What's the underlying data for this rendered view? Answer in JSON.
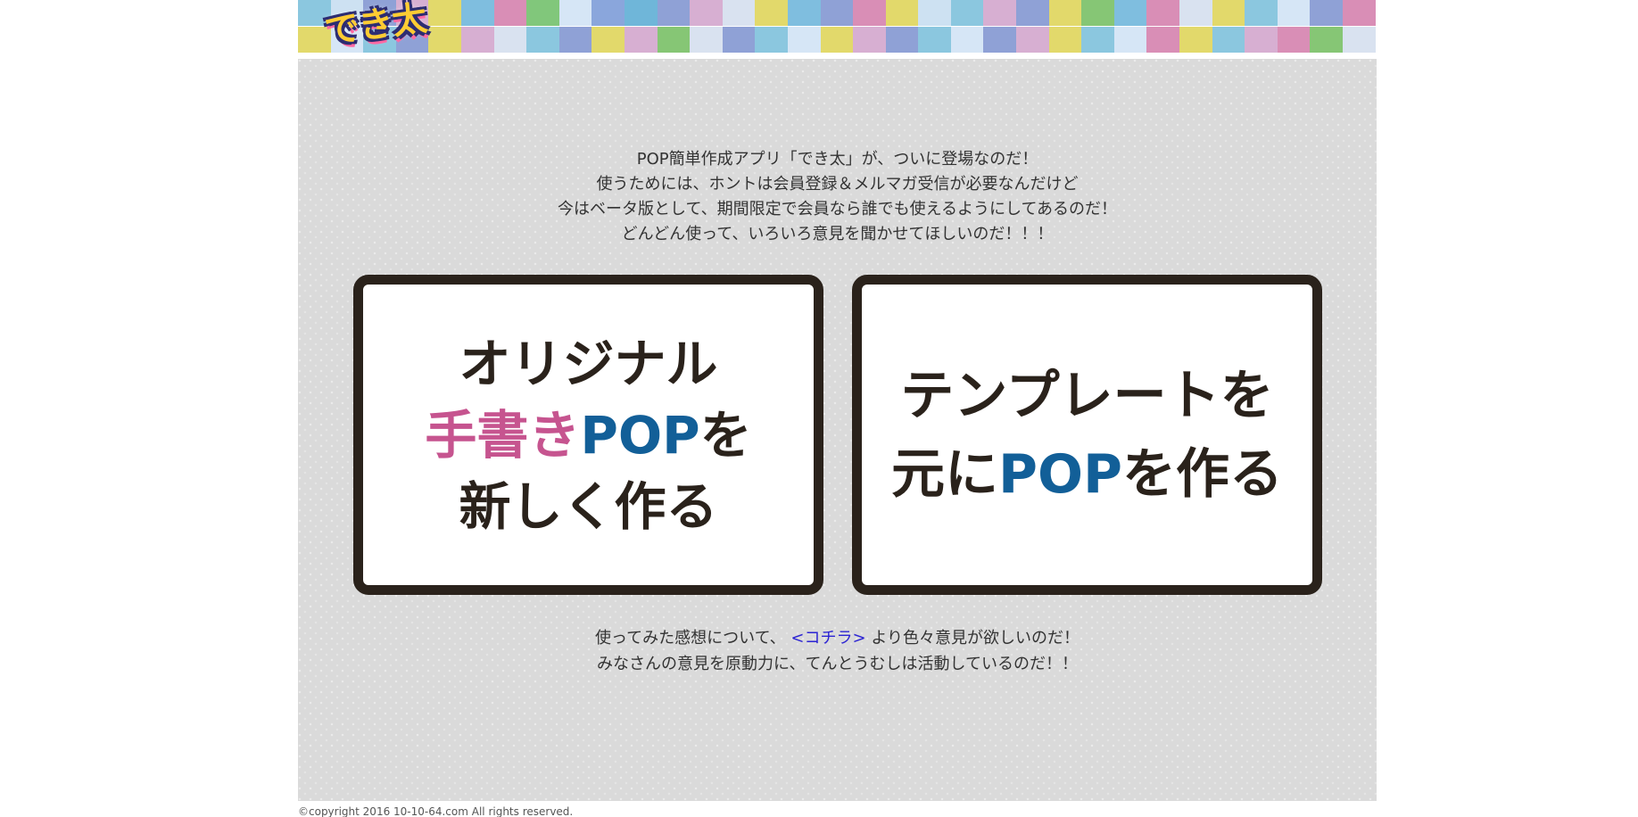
{
  "header": {
    "logo_text": "でき太",
    "checker_colors_top": [
      "#8bc7df",
      "#cde1f2",
      "#8fa1d6",
      "#d7afd2",
      "#e2d96b",
      "#7fbedf",
      "#d98eb6",
      "#81c77b",
      "#d6e6f6",
      "#8aa6dc",
      "#6fb6d9",
      "#8fa1d6",
      "#d7afd2",
      "#d9e2f0",
      "#e2d96b",
      "#7fbedf",
      "#8fa1d6",
      "#d98eb6",
      "#e2d96b",
      "#cde1f2",
      "#8bc7df",
      "#d7afd2",
      "#8fa1d6",
      "#e2d96b",
      "#86c675",
      "#7fbedf",
      "#d98eb6",
      "#d9e2f0",
      "#e2d96b",
      "#8bc7df",
      "#d6e6f6",
      "#8fa1d6",
      "#d98eb6"
    ],
    "checker_colors_bottom": [
      "#e2d96b",
      "#d6e6f6",
      "#8bc7df",
      "#8fa1d6",
      "#e2d96b",
      "#d7afd2",
      "#d9e2f0",
      "#8bc7df",
      "#8fa1d6",
      "#e2d96b",
      "#d7afd2",
      "#86c675",
      "#d9e2f0",
      "#8fa1d6",
      "#8bc7df",
      "#d6e6f6",
      "#e2d96b",
      "#d7afd2",
      "#8fa1d6",
      "#8bc7df",
      "#d6e6f6",
      "#8fa1d6",
      "#d7afd2",
      "#e2d96b",
      "#8bc7df",
      "#d6e6f6",
      "#d98eb6",
      "#e2d96b",
      "#8bc7df",
      "#d7afd2",
      "#d98eb6",
      "#86c675",
      "#d9e2f0"
    ]
  },
  "intro": {
    "lines": [
      "POP簡単作成アプリ「でき太」が、ついに登場なのだ！",
      "使うためには、ホントは会員登録＆メルマガ受信が必要なんだけど",
      "今はベータ版として、期間限定で会員なら誰でも使えるようにしてあるのだ！",
      "どんどん使って、いろいろ意見を聞かせてほしいのだ！！！"
    ]
  },
  "cards": {
    "original": {
      "line1": "オリジナル",
      "line2_pink": "手書き",
      "line2_blue": "POP",
      "line2_dark": "を",
      "line3": "新しく作る"
    },
    "template": {
      "line1": "テンプレートを",
      "line2_dark_start": "元に",
      "line2_blue": "POP",
      "line2_dark_end": "を作る"
    }
  },
  "outro": {
    "line1_before": "使ってみた感想について、",
    "link": "<コチラ>",
    "line1_after": "より色々意見が欲しいのだ！",
    "line2": "みなさんの意見を原動力に、てんとうむしは活動しているのだ！！"
  },
  "footer": {
    "copyright": "©copyright 2016 10-10-64.com All rights reserved."
  },
  "colors": {
    "content_background": "#dadada",
    "card_border": "#2a221b",
    "pink_text": "#c6548f",
    "blue_text": "#125f98",
    "link": "#2c24d3"
  }
}
